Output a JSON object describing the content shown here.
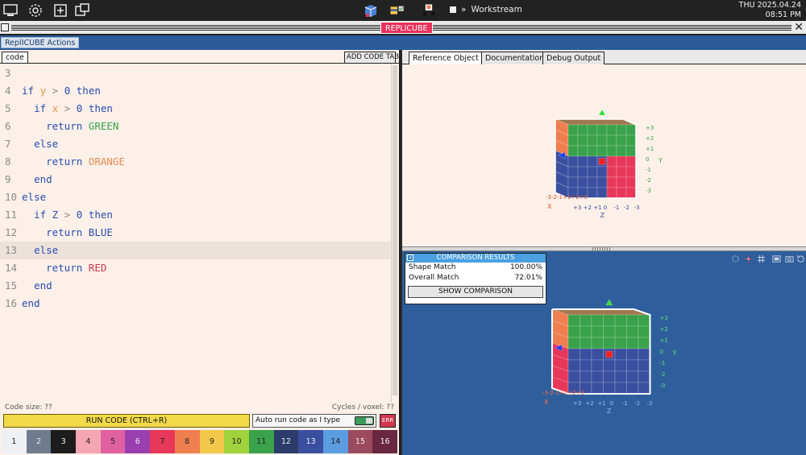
{
  "topbar": {
    "workstream": "Workstream",
    "clock_day": "THU 2025.04.24",
    "clock_time": "08:51 PM"
  },
  "titlebar": {
    "app_title": "REPLICUBE"
  },
  "actions": {
    "title": "ReplICUBE Actions"
  },
  "editor": {
    "tab_label": "code",
    "add_tab_label": "ADD CODE TAB",
    "lines": [
      {
        "n": "3",
        "text": ""
      },
      {
        "n": "4",
        "text": "if y > 0 then"
      },
      {
        "n": "5",
        "text": "  if x > 0 then"
      },
      {
        "n": "6",
        "text": "    return GREEN"
      },
      {
        "n": "7",
        "text": "  else"
      },
      {
        "n": "8",
        "text": "    return ORANGE"
      },
      {
        "n": "9",
        "text": "  end"
      },
      {
        "n": "10",
        "text": "else"
      },
      {
        "n": "11",
        "text": "  if Z > 0 then"
      },
      {
        "n": "12",
        "text": "    return BLUE"
      },
      {
        "n": "13",
        "text": "  else"
      },
      {
        "n": "14",
        "text": "    return RED"
      },
      {
        "n": "15",
        "text": "  end"
      },
      {
        "n": "16",
        "text": "end"
      }
    ],
    "highlighted_line": "13",
    "code_size": "Code size: ??",
    "cycles": "Cycles / voxel: ??",
    "run_label": "RUN CODE (CTRL+R)",
    "autorun_label": "Auto run code as I type",
    "err_label": "ERR"
  },
  "palette": [
    {
      "label": "1",
      "color": "#eef0f4"
    },
    {
      "label": "2",
      "color": "#6f7b8f"
    },
    {
      "label": "3",
      "color": "#1c1c1c"
    },
    {
      "label": "4",
      "color": "#f4a7b2"
    },
    {
      "label": "5",
      "color": "#e060a0"
    },
    {
      "label": "6",
      "color": "#9a3fb0"
    },
    {
      "label": "7",
      "color": "#e8385a"
    },
    {
      "label": "8",
      "color": "#f07f50"
    },
    {
      "label": "9",
      "color": "#f2c84a"
    },
    {
      "label": "10",
      "color": "#9fd23c"
    },
    {
      "label": "11",
      "color": "#3aa24a"
    },
    {
      "label": "12",
      "color": "#2c3c6a"
    },
    {
      "label": "13",
      "color": "#3a4fa0"
    },
    {
      "label": "14",
      "color": "#5c9ce0"
    },
    {
      "label": "15",
      "color": "#9c4a60"
    },
    {
      "label": "16",
      "color": "#6a2840"
    }
  ],
  "right": {
    "tabs": [
      "Reference Object",
      "Documentation",
      "Debug Output"
    ],
    "active_tab": "Reference Object",
    "axes": {
      "y_ticks": [
        "+3",
        "+2",
        "+1",
        "0",
        "-1",
        "-2",
        "-3"
      ],
      "z_ticks": [
        "+3",
        "+2",
        "+1",
        "0",
        "-1",
        "-2",
        "-3"
      ],
      "x_ticks": "-3-2-1+1+2+3",
      "y_label": "Y",
      "x_label": "X",
      "z_label": "Z"
    },
    "comparison": {
      "title": "COMPARISON RESULTS",
      "shape_label": "Shape Match",
      "shape_value": "100.00%",
      "overall_label": "Overall Match",
      "overall_value": "72.01%",
      "button": "SHOW COMPARISON"
    }
  },
  "colors": {
    "green": "#3aa24a",
    "orange": "#f07f50",
    "blue": "#3a4fa0",
    "red": "#e8385a",
    "pink": "#e8385a"
  }
}
